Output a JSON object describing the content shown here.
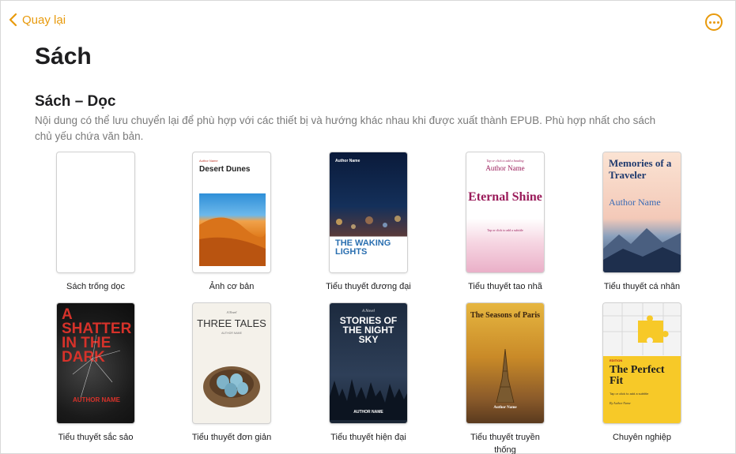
{
  "header": {
    "back_label": "Quay lại",
    "more_icon": "ellipsis-circle-icon",
    "accent": "#e89a0c"
  },
  "page_title": "Sách",
  "section": {
    "title": "Sách – Dọc",
    "description": "Nội dung có thể lưu chuyển lại để phù hợp với các thiết bị và hướng khác nhau khi được xuất thành EPUB. Phù hợp nhất cho sách chủ yếu chứa văn bản."
  },
  "templates": [
    {
      "label": "Sách trống dọc"
    },
    {
      "label": "Ảnh cơ bản",
      "cover": {
        "small": "Author Name",
        "title": "Desert Dunes"
      }
    },
    {
      "label": "Tiểu thuyết đương đại",
      "cover": {
        "small": "Author Name",
        "title": "THE WAKING LIGHTS"
      }
    },
    {
      "label": "Tiểu thuyết tao nhã",
      "cover": {
        "small": "Tap or click to add a heading",
        "author": "Author Name",
        "title": "Eternal Shine",
        "sub": "Tap or click to add a subtitle"
      }
    },
    {
      "label": "Tiểu thuyết cá nhân",
      "cover": {
        "title": "Memories of a Traveler",
        "author": "Author Name"
      }
    },
    {
      "label": "Tiểu thuyết sắc sảo",
      "cover": {
        "title": "A SHATTER IN THE DARK",
        "author": "AUTHOR NAME"
      }
    },
    {
      "label": "Tiểu thuyết đơn giản",
      "cover": {
        "small": "A Novel",
        "title": "THREE TALES",
        "author": "AUTHOR NAME"
      }
    },
    {
      "label": "Tiểu thuyết hiện đại",
      "cover": {
        "small": "A Novel",
        "title": "STORIES OF THE NIGHT SKY",
        "author": "AUTHOR NAME"
      }
    },
    {
      "label": "Tiểu thuyết truyền thống",
      "cover": {
        "title": "The Seasons of Paris",
        "author": "Author Name"
      }
    },
    {
      "label": "Chuyên nghiệp",
      "cover": {
        "small": "EDITION",
        "title": "The Perfect Fit",
        "sub": "Tap or click to add a subtitle",
        "author": "By Author Name"
      }
    }
  ]
}
